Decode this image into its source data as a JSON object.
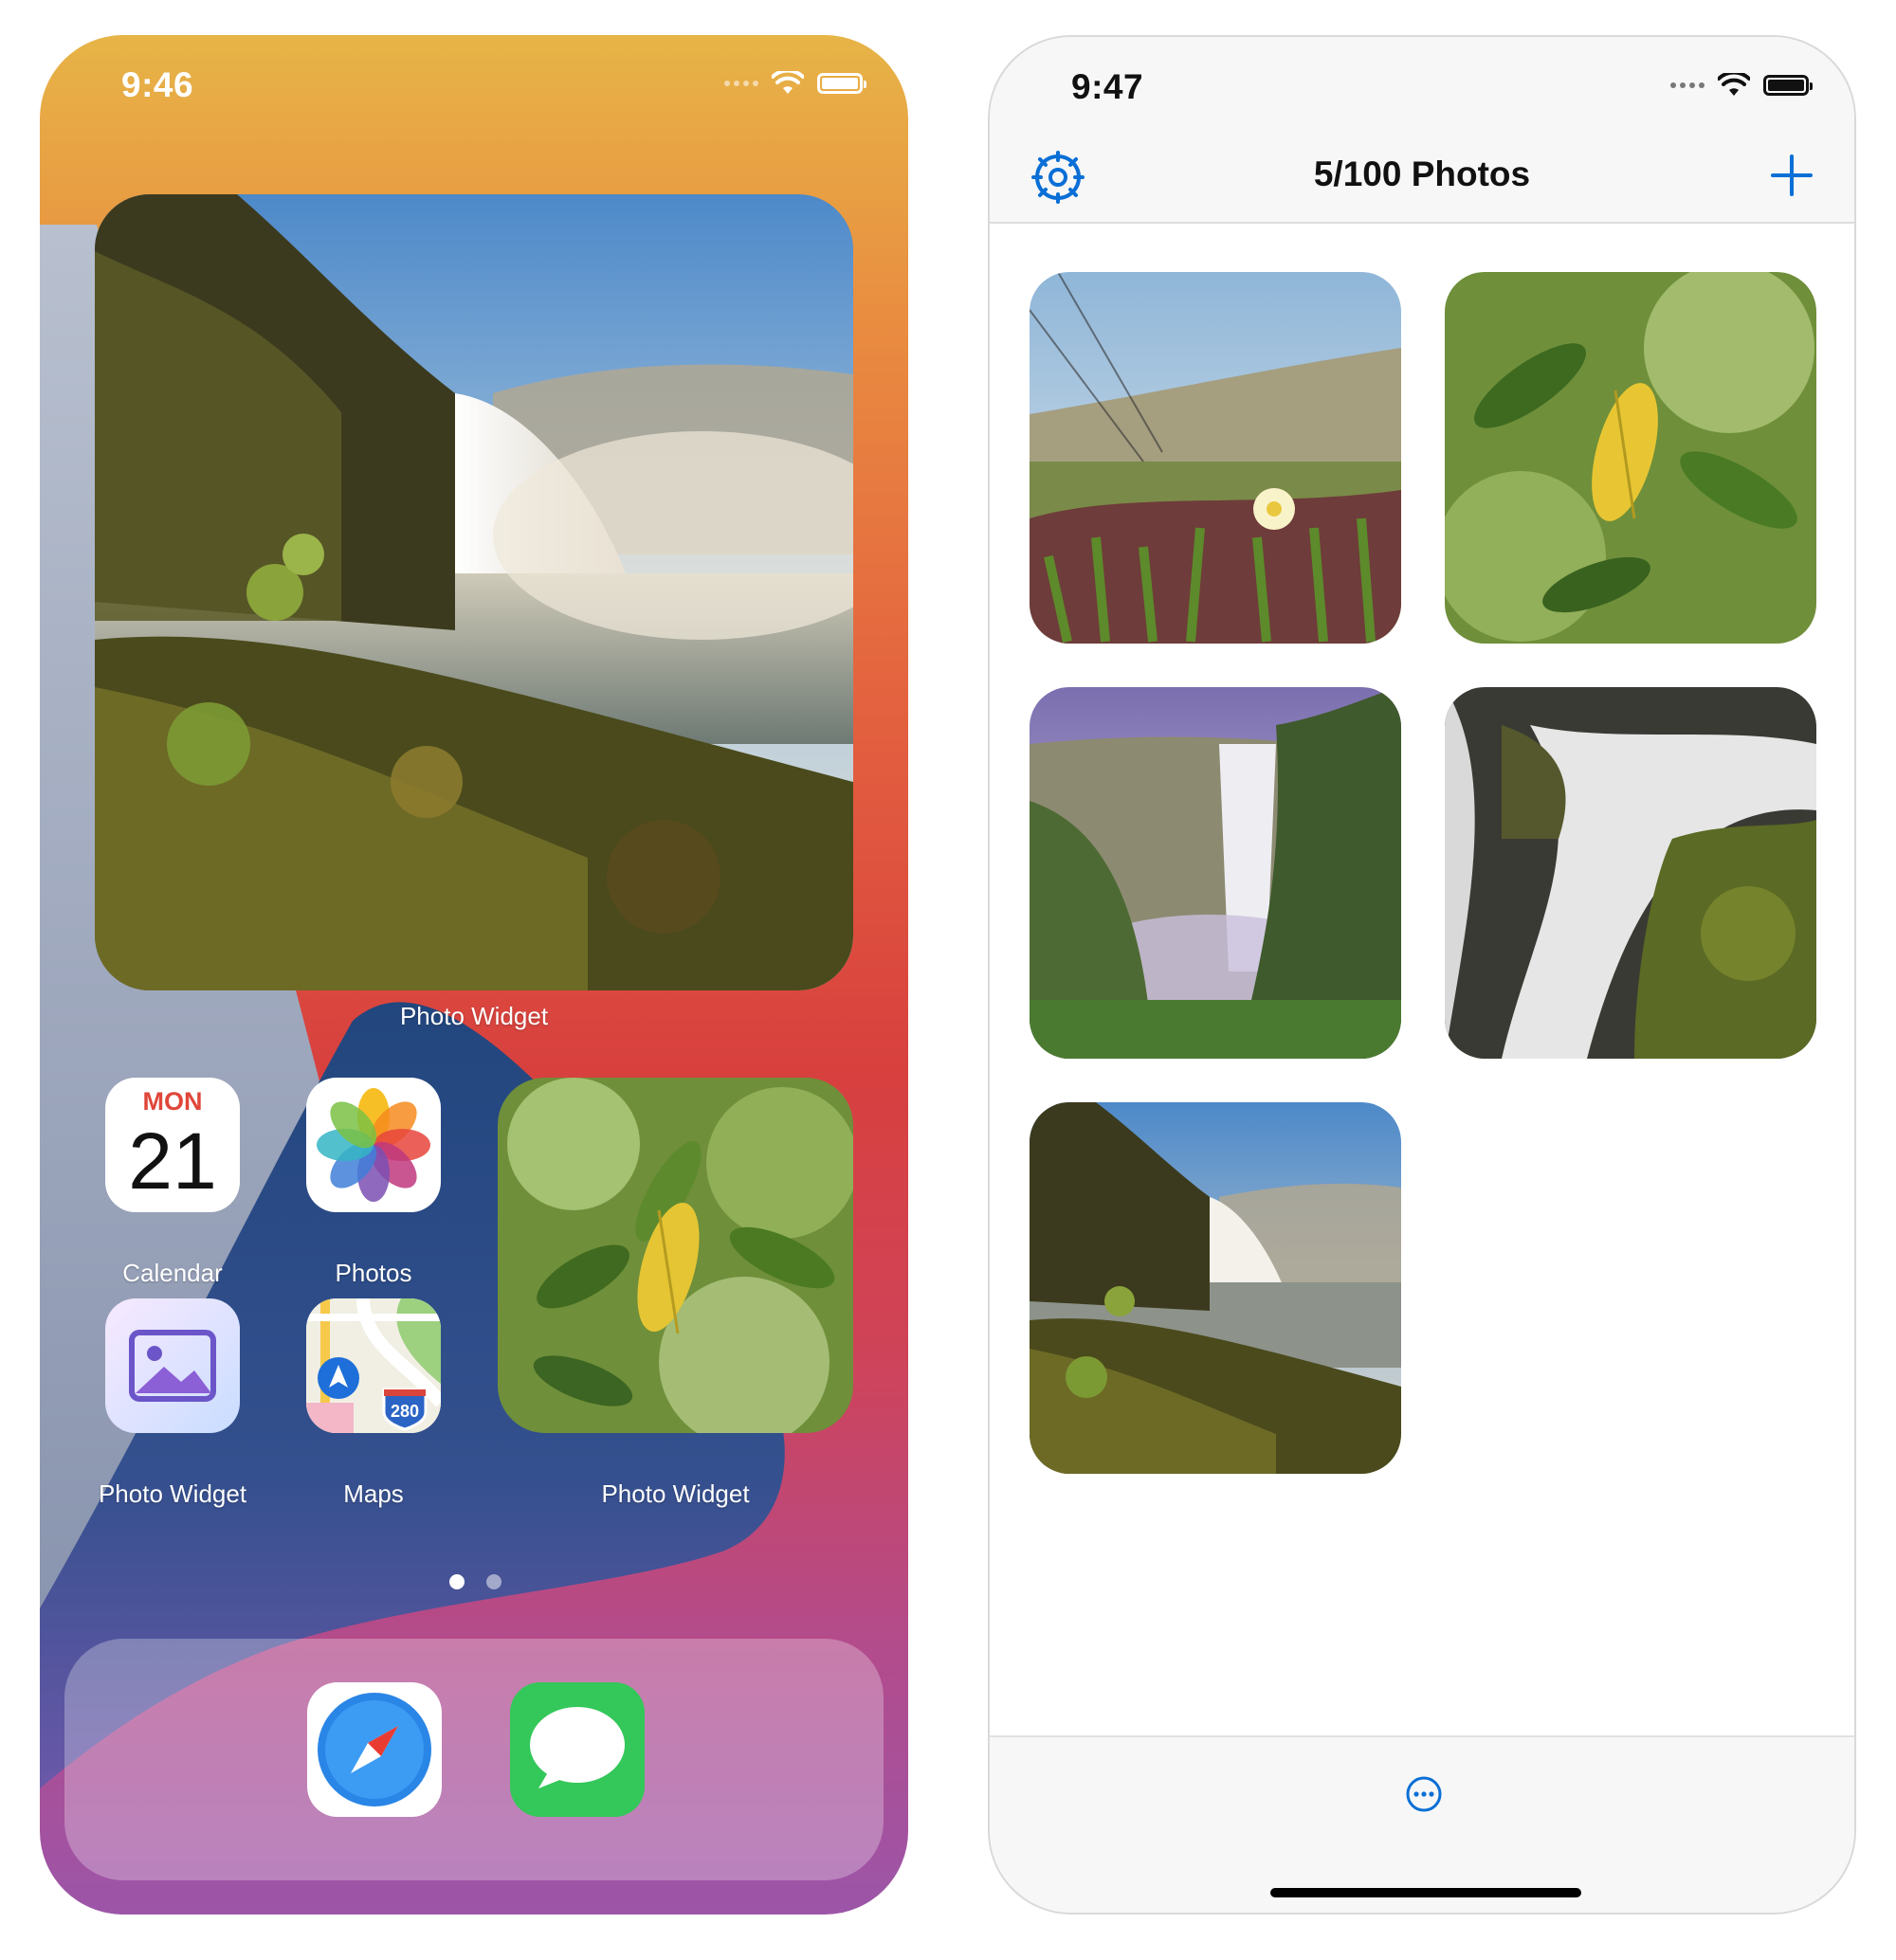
{
  "left_screen": {
    "status_time": "9:46",
    "large_widget_label": "Photo Widget",
    "calendar": {
      "day": "MON",
      "date": "21",
      "label": "Calendar"
    },
    "apps": {
      "photos_label": "Photos",
      "photo_widget_label": "Photo Widget",
      "maps_label": "Maps",
      "maps_shield": "280"
    },
    "small_widget_label": "Photo Widget",
    "page_indicator": {
      "pages": 2,
      "current": 1
    },
    "dock": [
      "safari-icon",
      "messages-icon"
    ]
  },
  "right_screen": {
    "status_time": "9:47",
    "nav_title": "5/100 Photos",
    "settings_icon": "gear-icon",
    "add_icon": "plus-icon",
    "more_icon": "ellipsis-circle-icon",
    "photos": [
      "flower-meadow",
      "green-leaves",
      "waterfall-canyon",
      "rapids-moss",
      "waterfall-cliff"
    ]
  },
  "colors": {
    "accent": "#0a6fd6",
    "calendar_red": "#e0463a",
    "messages_green": "#34c759"
  }
}
